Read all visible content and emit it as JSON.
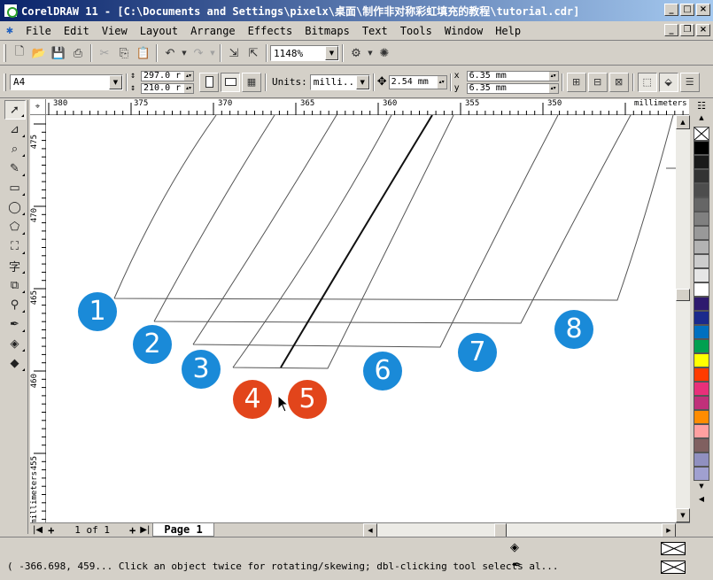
{
  "window": {
    "title": "CorelDRAW 11 - [C:\\Documents and Settings\\pixelx\\桌面\\制作非对称彩虹填充的教程\\tutorial.cdr]",
    "controls": [
      "_",
      "□",
      "×"
    ]
  },
  "menu": {
    "items": [
      "File",
      "Edit",
      "View",
      "Layout",
      "Arrange",
      "Effects",
      "Bitmaps",
      "Text",
      "Tools",
      "Window",
      "Help"
    ],
    "doc_controls": [
      "_",
      "❐",
      "×"
    ]
  },
  "toolbar_standard": {
    "zoom_value": "1148%"
  },
  "property_bar": {
    "paper_size": "A4",
    "width": "297.0 r",
    "height": "210.0 r",
    "units_label": "Units:",
    "units_value": "milli...",
    "nudge": "2.54 mm",
    "dup_x": "6.35 mm",
    "dup_y": "6.35 mm",
    "dup_x_label": "x",
    "dup_y_label": "y"
  },
  "ruler_top": {
    "ticks": [
      "380",
      "375",
      "370",
      "365",
      "360",
      "355",
      "350"
    ],
    "unit": "millimeters"
  },
  "ruler_left": {
    "ticks": [
      "475",
      "470",
      "465",
      "460",
      "455"
    ],
    "unit": "millimeters"
  },
  "badges": [
    {
      "label": "1",
      "color": "#1a8ad8"
    },
    {
      "label": "2",
      "color": "#1a8ad8"
    },
    {
      "label": "3",
      "color": "#1a8ad8"
    },
    {
      "label": "4",
      "color": "#e2451b"
    },
    {
      "label": "5",
      "color": "#e2451b"
    },
    {
      "label": "6",
      "color": "#1a8ad8"
    },
    {
      "label": "7",
      "color": "#1a8ad8"
    },
    {
      "label": "8",
      "color": "#1a8ad8"
    }
  ],
  "page_nav": {
    "counter": "1 of 1",
    "tab": "Page 1"
  },
  "status": {
    "text": "( -366.698, 459... Click an object twice for rotating/skewing; dbl-clicking tool selects al..."
  },
  "palette_colors": [
    "#ffffff",
    "#000000",
    "#1a1a1a",
    "#333333",
    "#4d4d4d",
    "#666666",
    "#808080",
    "#999999",
    "#b3b3b3",
    "#cccccc",
    "#e6e6e6",
    "#ffffff",
    "#2e1a6e",
    "#1b2a8c",
    "#0070c0",
    "#00a050",
    "#ffff00",
    "#ff3b00",
    "#e8307a",
    "#c0307a",
    "#ff8c00",
    "#ffa0a0",
    "#806060",
    "#9090c0",
    "#a0a0d0"
  ]
}
